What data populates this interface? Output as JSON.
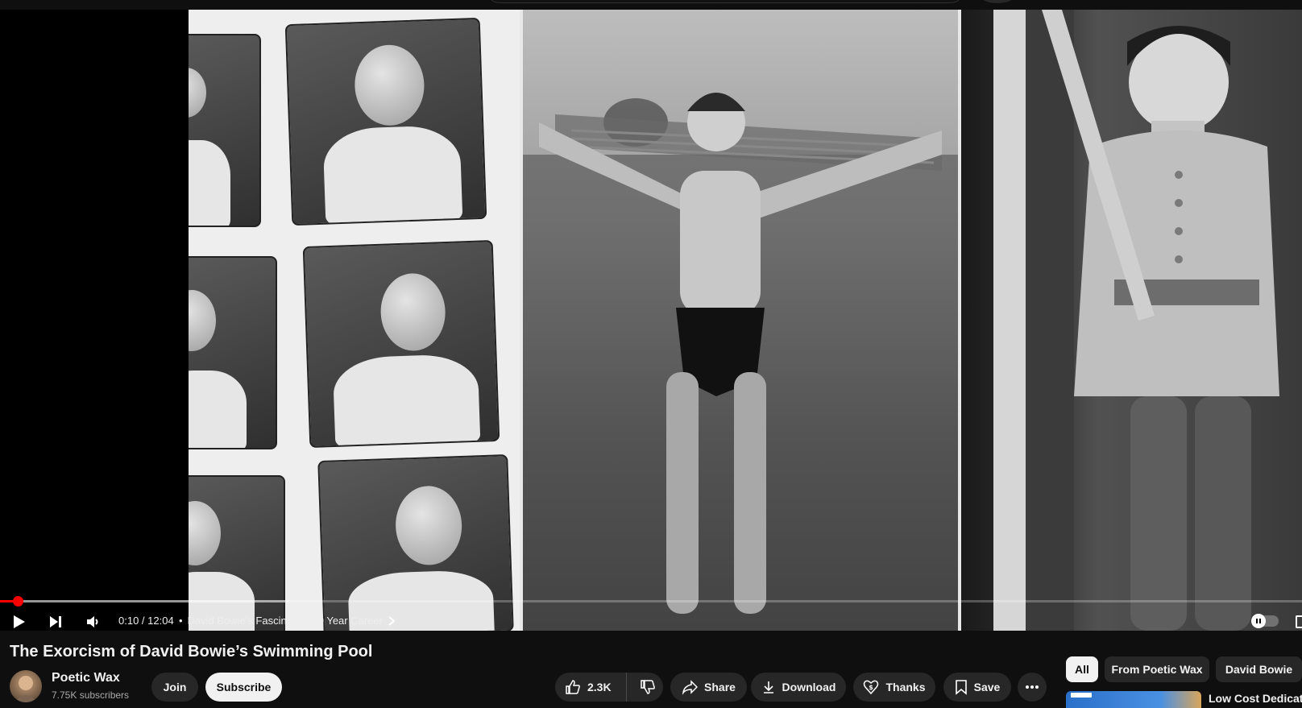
{
  "player": {
    "time_display": "0:10 / 12:04",
    "chapter_separator": "•",
    "chapter_title": "David Bowie's Fascinating 50 Year Career",
    "progress_played_fraction": 0.0138,
    "progress_loaded_fraction": 0.222,
    "icons": {
      "play": "play-icon",
      "next": "next-icon",
      "volume": "volume-icon",
      "chapter_chevron": "chevron-right-icon",
      "autoplay": "autoplay-toggle-icon"
    }
  },
  "video": {
    "title": "The Exorcism of David Bowie’s Swimming Pool"
  },
  "channel": {
    "name": "Poetic Wax",
    "subscribers": "7.75K subscribers",
    "join_label": "Join",
    "subscribe_label": "Subscribe"
  },
  "actions": {
    "like_count": "2.3K",
    "share_label": "Share",
    "download_label": "Download",
    "thanks_label": "Thanks",
    "save_label": "Save"
  },
  "chips": {
    "all": "All",
    "from_channel": "From Poetic Wax",
    "topic": "David Bowie"
  },
  "recommendation": {
    "title": "Low Cost Dedicate"
  },
  "colors": {
    "background": "#0f0f0f",
    "progress_red": "#ff0000",
    "pill_bg": "#272727",
    "subscribe_bg": "#f1f1f1"
  }
}
